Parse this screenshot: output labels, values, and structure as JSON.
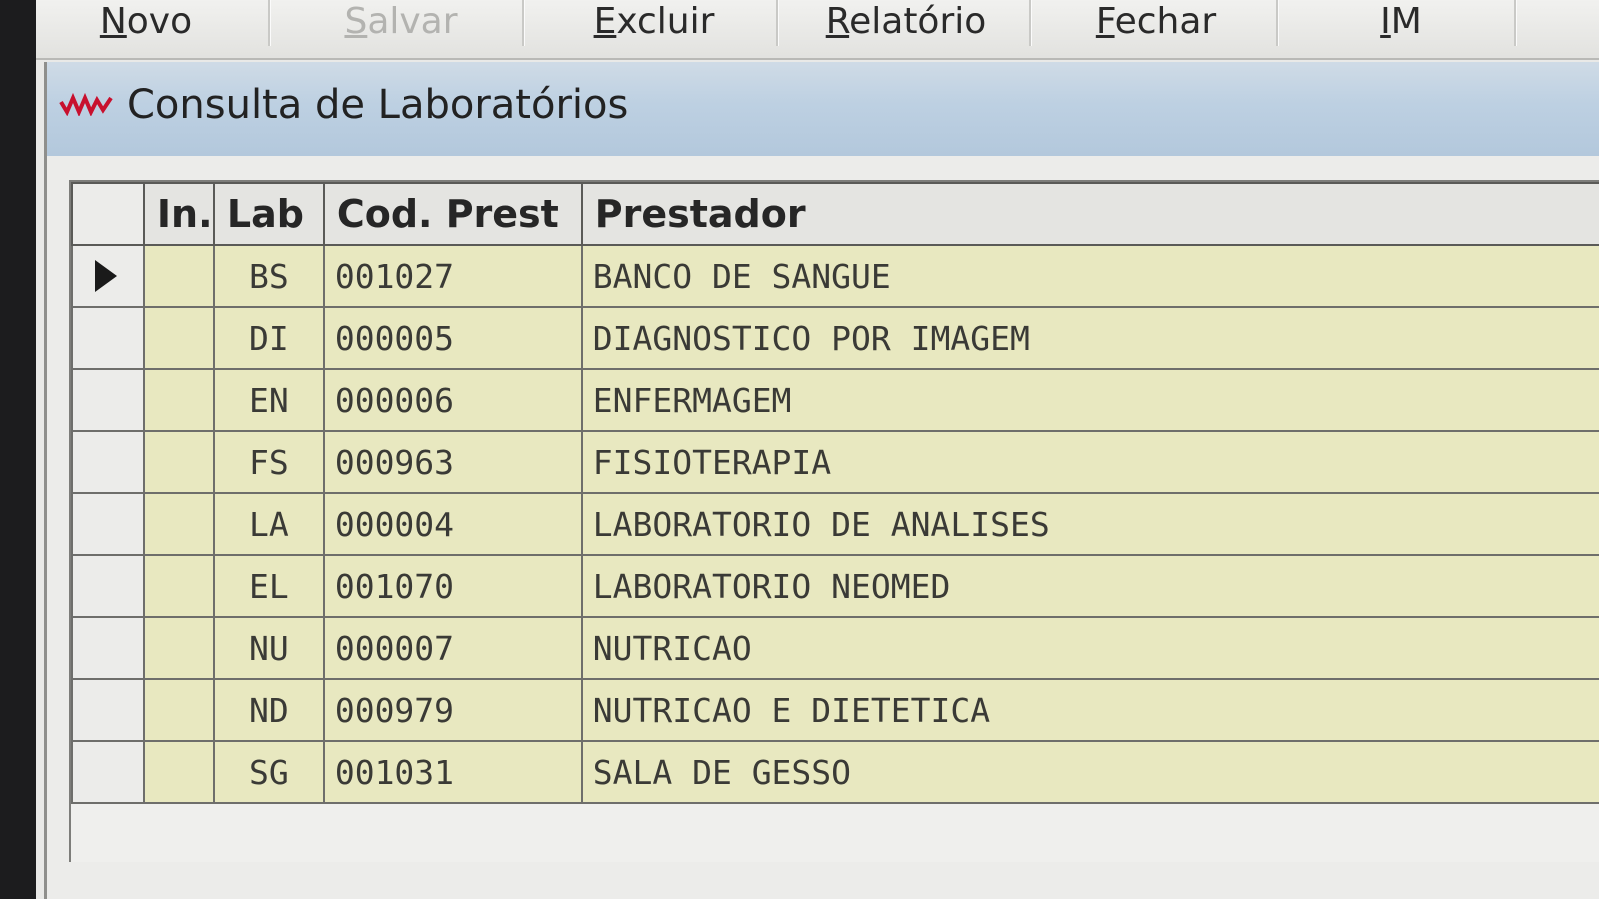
{
  "toolbar": {
    "buttons": [
      {
        "label": "Novo",
        "enabled": true
      },
      {
        "label": "Salvar",
        "enabled": false
      },
      {
        "label": "Excluir",
        "enabled": true
      },
      {
        "label": "Relatório",
        "enabled": true
      },
      {
        "label": "Fechar",
        "enabled": true
      },
      {
        "label": "IM",
        "enabled": true
      }
    ]
  },
  "window": {
    "title": "Consulta de Laboratórios",
    "icon": "lab-logo-icon"
  },
  "grid": {
    "columns": [
      "",
      "In.",
      "Lab",
      "Cod. Prest",
      "Prestador"
    ],
    "selected_row": 0,
    "rows": [
      {
        "in": "",
        "lab": "BS",
        "cod": "001027",
        "prestador": "BANCO DE SANGUE"
      },
      {
        "in": "",
        "lab": "DI",
        "cod": "000005",
        "prestador": "DIAGNOSTICO POR IMAGEM"
      },
      {
        "in": "",
        "lab": "EN",
        "cod": "000006",
        "prestador": "ENFERMAGEM"
      },
      {
        "in": "",
        "lab": "FS",
        "cod": "000963",
        "prestador": "FISIOTERAPIA"
      },
      {
        "in": "",
        "lab": "LA",
        "cod": "000004",
        "prestador": "LABORATORIO DE ANALISES"
      },
      {
        "in": "",
        "lab": "EL",
        "cod": "001070",
        "prestador": "LABORATORIO NEOMED"
      },
      {
        "in": "",
        "lab": "NU",
        "cod": "000007",
        "prestador": "NUTRICAO"
      },
      {
        "in": "",
        "lab": "ND",
        "cod": "000979",
        "prestador": "NUTRICAO E DIETETICA"
      },
      {
        "in": "",
        "lab": "SG",
        "cod": "001031",
        "prestador": "SALA DE GESSO"
      }
    ]
  },
  "colors": {
    "row_background": "#e8e8c0",
    "titlebar": "#bdd0e2",
    "icon_red": "#c8102e"
  }
}
